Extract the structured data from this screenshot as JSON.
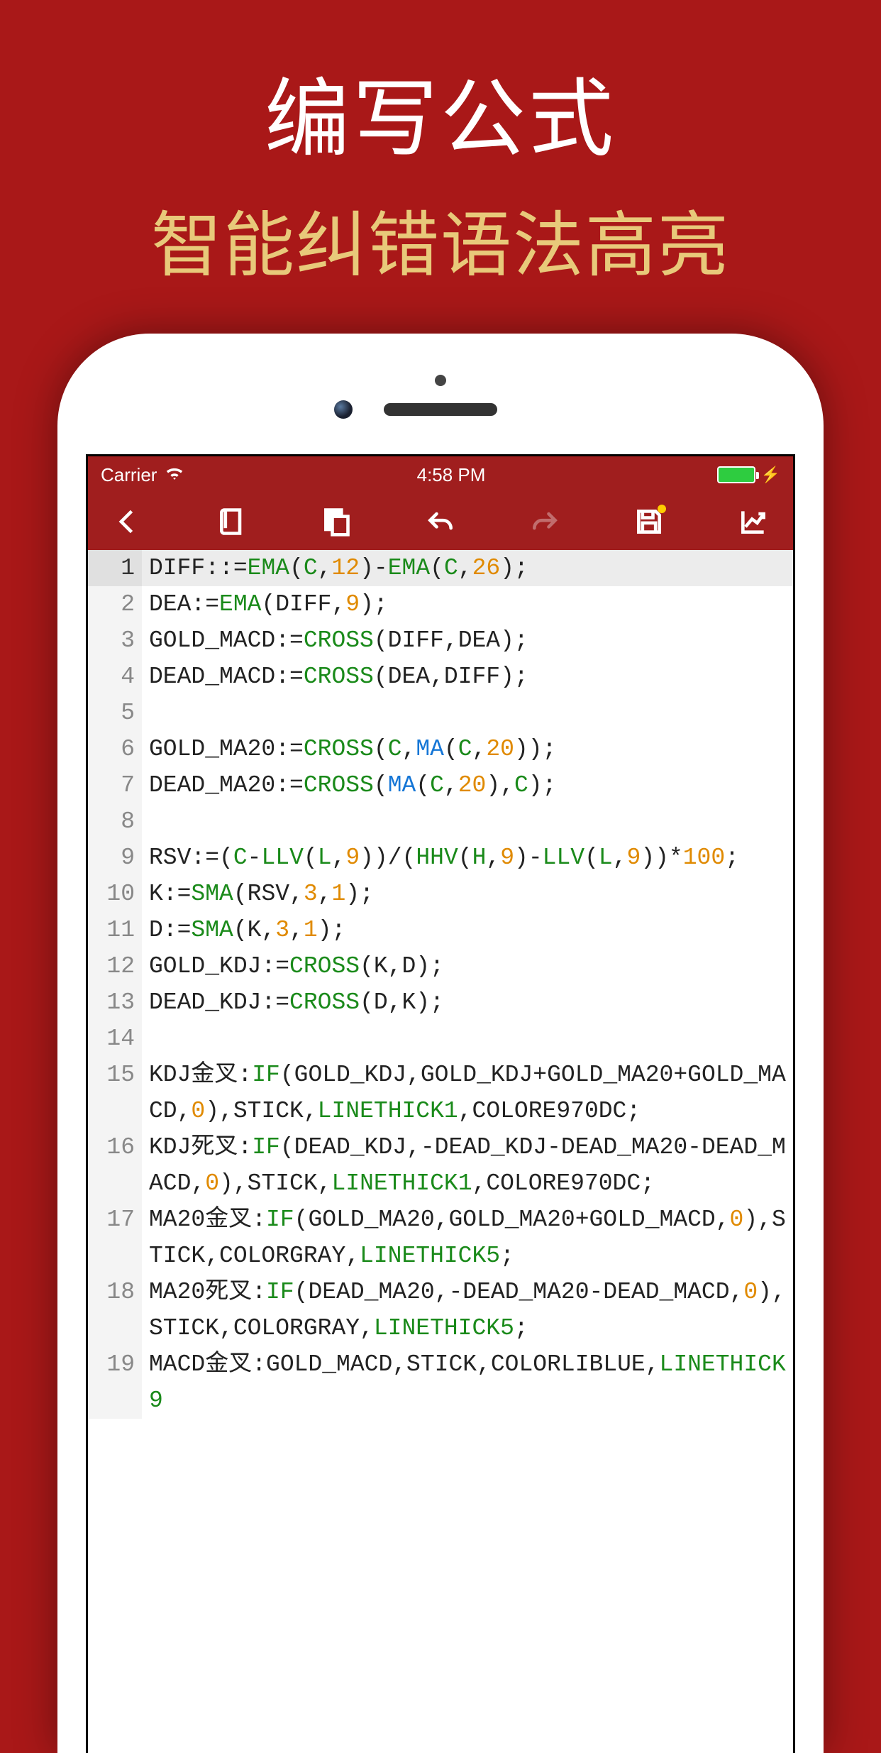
{
  "promo": {
    "title": "编写公式",
    "subtitle": "智能纠错语法高亮"
  },
  "statusbar": {
    "carrier": "Carrier",
    "time": "4:58 PM"
  },
  "toolbar": {
    "back": "back",
    "book": "book",
    "paste": "paste",
    "undo": "undo",
    "redo": "redo",
    "save": "save",
    "chart": "chart"
  },
  "code_lines": [
    {
      "n": 1,
      "current": true,
      "segs": [
        [
          "id",
          "DIFF"
        ],
        [
          "p",
          ":"
        ],
        [
          "p",
          ":="
        ],
        [
          "kw",
          "EMA"
        ],
        [
          "p",
          "("
        ],
        [
          "var",
          "C"
        ],
        [
          "p",
          ","
        ],
        [
          "num",
          "12"
        ],
        [
          "p",
          ")-"
        ],
        [
          "kw",
          "EMA"
        ],
        [
          "p",
          "("
        ],
        [
          "var",
          "C"
        ],
        [
          "p",
          ","
        ],
        [
          "num",
          "26"
        ],
        [
          "p",
          ");"
        ]
      ]
    },
    {
      "n": 2,
      "segs": [
        [
          "id",
          "DEA"
        ],
        [
          "p",
          ":="
        ],
        [
          "kw",
          "EMA"
        ],
        [
          "p",
          "(DIFF,"
        ],
        [
          "num",
          "9"
        ],
        [
          "p",
          ");"
        ]
      ]
    },
    {
      "n": 3,
      "segs": [
        [
          "id",
          "GOLD_MACD"
        ],
        [
          "p",
          ":="
        ],
        [
          "kw",
          "CROSS"
        ],
        [
          "p",
          "(DIFF,DEA);"
        ]
      ]
    },
    {
      "n": 4,
      "segs": [
        [
          "id",
          "DEAD_MACD"
        ],
        [
          "p",
          ":="
        ],
        [
          "kw",
          "CROSS"
        ],
        [
          "p",
          "(DEA,DIFF);"
        ]
      ]
    },
    {
      "n": 5,
      "segs": []
    },
    {
      "n": 6,
      "segs": [
        [
          "id",
          "GOLD_MA20"
        ],
        [
          "p",
          ":="
        ],
        [
          "kw",
          "CROSS"
        ],
        [
          "p",
          "("
        ],
        [
          "var",
          "C"
        ],
        [
          "p",
          ","
        ],
        [
          "fn",
          "MA"
        ],
        [
          "p",
          "("
        ],
        [
          "var",
          "C"
        ],
        [
          "p",
          ","
        ],
        [
          "num",
          "20"
        ],
        [
          "p",
          "));"
        ]
      ]
    },
    {
      "n": 7,
      "segs": [
        [
          "id",
          "DEAD_MA20"
        ],
        [
          "p",
          ":="
        ],
        [
          "kw",
          "CROSS"
        ],
        [
          "p",
          "("
        ],
        [
          "fn",
          "MA"
        ],
        [
          "p",
          "("
        ],
        [
          "var",
          "C"
        ],
        [
          "p",
          ","
        ],
        [
          "num",
          "20"
        ],
        [
          "p",
          "),"
        ],
        [
          "var",
          "C"
        ],
        [
          "p",
          ");"
        ]
      ]
    },
    {
      "n": 8,
      "segs": []
    },
    {
      "n": 9,
      "segs": [
        [
          "id",
          "RSV"
        ],
        [
          "p",
          ":=("
        ],
        [
          "var",
          "C"
        ],
        [
          "p",
          "-"
        ],
        [
          "kw",
          "LLV"
        ],
        [
          "p",
          "("
        ],
        [
          "var",
          "L"
        ],
        [
          "p",
          ","
        ],
        [
          "num",
          "9"
        ],
        [
          "p",
          "))/("
        ],
        [
          "kw",
          "HHV"
        ],
        [
          "p",
          "("
        ],
        [
          "var",
          "H"
        ],
        [
          "p",
          ","
        ],
        [
          "num",
          "9"
        ],
        [
          "p",
          ")-"
        ],
        [
          "kw",
          "LLV"
        ],
        [
          "p",
          "("
        ],
        [
          "var",
          "L"
        ],
        [
          "p",
          ","
        ],
        [
          "num",
          "9"
        ],
        [
          "p",
          "))*"
        ],
        [
          "num",
          "100"
        ],
        [
          "p",
          ";"
        ]
      ]
    },
    {
      "n": 10,
      "segs": [
        [
          "id",
          "K"
        ],
        [
          "p",
          ":="
        ],
        [
          "kw",
          "SMA"
        ],
        [
          "p",
          "(RSV,"
        ],
        [
          "num",
          "3"
        ],
        [
          "p",
          ","
        ],
        [
          "num",
          "1"
        ],
        [
          "p",
          ");"
        ]
      ]
    },
    {
      "n": 11,
      "segs": [
        [
          "id",
          "D"
        ],
        [
          "p",
          ":="
        ],
        [
          "kw",
          "SMA"
        ],
        [
          "p",
          "(K,"
        ],
        [
          "num",
          "3"
        ],
        [
          "p",
          ","
        ],
        [
          "num",
          "1"
        ],
        [
          "p",
          ");"
        ]
      ]
    },
    {
      "n": 12,
      "segs": [
        [
          "id",
          "GOLD_KDJ"
        ],
        [
          "p",
          ":="
        ],
        [
          "kw",
          "CROSS"
        ],
        [
          "p",
          "(K,D);"
        ]
      ]
    },
    {
      "n": 13,
      "segs": [
        [
          "id",
          "DEAD_KDJ"
        ],
        [
          "p",
          ":="
        ],
        [
          "kw",
          "CROSS"
        ],
        [
          "p",
          "(D,K);"
        ]
      ]
    },
    {
      "n": 14,
      "segs": []
    },
    {
      "n": 15,
      "segs": [
        [
          "id",
          "KDJ金叉"
        ],
        [
          "p",
          ":"
        ],
        [
          "kw",
          "IF"
        ],
        [
          "p",
          "(GOLD_KDJ,GOLD_KDJ+GOLD_MA20+GOLD_MACD,"
        ],
        [
          "num",
          "0"
        ],
        [
          "p",
          "),STICK,"
        ],
        [
          "style",
          "LINETHICK1"
        ],
        [
          "p",
          ",COLORE970DC;"
        ]
      ]
    },
    {
      "n": 16,
      "segs": [
        [
          "id",
          "KDJ死叉"
        ],
        [
          "p",
          ":"
        ],
        [
          "kw",
          "IF"
        ],
        [
          "p",
          "(DEAD_KDJ,-DEAD_KDJ-DEAD_MA20-DEAD_MACD,"
        ],
        [
          "num",
          "0"
        ],
        [
          "p",
          "),STICK,"
        ],
        [
          "style",
          "LINETHICK1"
        ],
        [
          "p",
          ",COLORE970DC;"
        ]
      ]
    },
    {
      "n": 17,
      "segs": [
        [
          "id",
          "MA20金叉"
        ],
        [
          "p",
          ":"
        ],
        [
          "kw",
          "IF"
        ],
        [
          "p",
          "(GOLD_MA20,GOLD_MA20+GOLD_MACD,"
        ],
        [
          "num",
          "0"
        ],
        [
          "p",
          "),STICK,COLORGRAY,"
        ],
        [
          "style",
          "LINETHICK5"
        ],
        [
          "p",
          ";"
        ]
      ]
    },
    {
      "n": 18,
      "segs": [
        [
          "id",
          "MA20死叉"
        ],
        [
          "p",
          ":"
        ],
        [
          "kw",
          "IF"
        ],
        [
          "p",
          "(DEAD_MA20,-DEAD_MA20-DEAD_MACD,"
        ],
        [
          "num",
          "0"
        ],
        [
          "p",
          "),STICK,COLORGRAY,"
        ],
        [
          "style",
          "LINETHICK5"
        ],
        [
          "p",
          ";"
        ]
      ]
    },
    {
      "n": 19,
      "segs": [
        [
          "id",
          "MACD金叉"
        ],
        [
          "p",
          ":GOLD_MACD,STICK,COLORLIBLUE,"
        ],
        [
          "style",
          "LINETHICK9"
        ]
      ]
    }
  ]
}
